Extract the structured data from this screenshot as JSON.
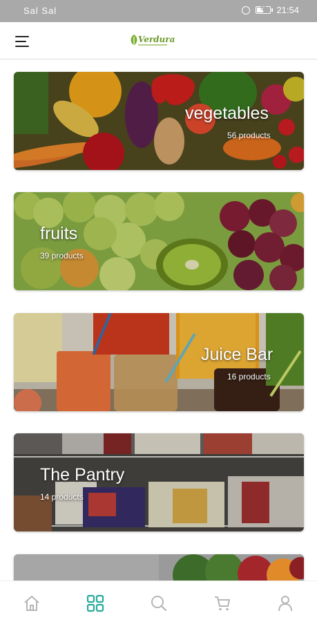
{
  "status_bar": {
    "signal_text": "Sal Sal",
    "battery_level": 0.5,
    "battery_text": "50",
    "time": "21:54"
  },
  "header": {
    "logo_text": "Verdura",
    "menu_icon": "hamburger-menu-icon"
  },
  "categories": [
    {
      "title": "vegetables",
      "count": "56 products",
      "image": "vegetables-photo"
    },
    {
      "title": "fruits",
      "count": "39 products",
      "image": "fruits-photo"
    },
    {
      "title": "Juice Bar",
      "count": "16 products",
      "image": "juice-bar-photo"
    },
    {
      "title": "The Pantry",
      "count": "14 products",
      "image": "pantry-photo"
    }
  ],
  "bottom_nav": {
    "items": [
      "home-icon",
      "categories-grid-icon",
      "search-icon",
      "cart-icon",
      "profile-icon"
    ],
    "active": "categories-grid-icon",
    "active_color": "#26a99a",
    "inactive_color": "#b5b5b5"
  },
  "colors": {
    "brand_green": "#6b9a2a",
    "status_bar": "#a9a9a9"
  }
}
